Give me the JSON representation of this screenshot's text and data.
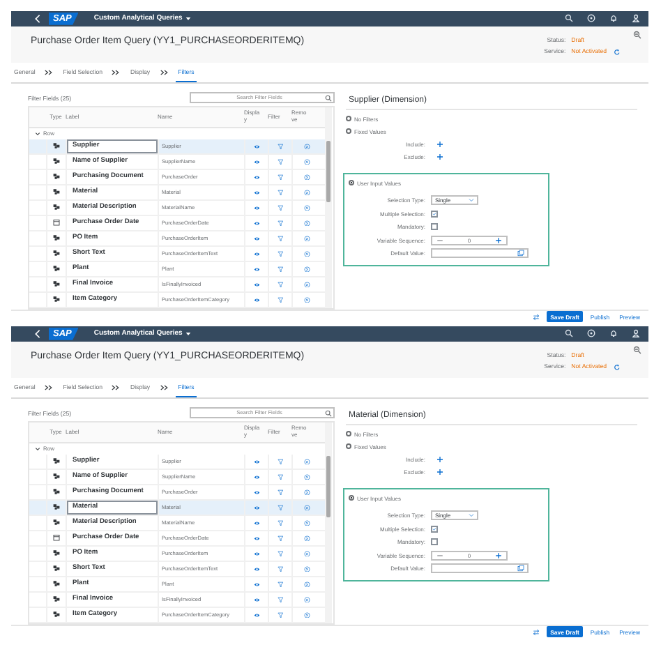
{
  "screens": [
    {
      "shell": {
        "logo": "SAP",
        "app_title": "Custom Analytical Queries"
      },
      "title": "Purchase Order Item Query (YY1_PURCHASEORDERITEMQ)",
      "status_label": "Status:",
      "status": "Draft",
      "service_label": "Service:",
      "service": "Not Activated",
      "tabs": [
        {
          "label": "General",
          "selected": false
        },
        {
          "label": "Field Selection",
          "selected": false
        },
        {
          "label": "Display",
          "selected": false
        },
        {
          "label": "Filters",
          "selected": true
        }
      ],
      "filter_fields": "Filter Fields (25)",
      "search": {
        "placeholder": "Search Filter Fields"
      },
      "columns": [
        "Type",
        "Label",
        "Name",
        "Display",
        "Filter",
        "Remove"
      ],
      "group": {
        "label": "Row",
        "expanded": true
      },
      "rows": [
        {
          "kind": "dimension",
          "label": "Supplier",
          "name": "Supplier",
          "selected": true
        },
        {
          "kind": "dimension",
          "label": "Name of Supplier",
          "name": "SupplierName",
          "selected": false
        },
        {
          "kind": "dimension",
          "label": "Purchasing Document",
          "name": "PurchaseOrder",
          "selected": false
        },
        {
          "kind": "dimension",
          "label": "Material",
          "name": "Material",
          "selected": false
        },
        {
          "kind": "dimension",
          "label": "Material Description",
          "name": "MaterialName",
          "selected": false
        },
        {
          "kind": "date",
          "label": "Purchase Order Date",
          "name": "PurchaseOrderDate",
          "selected": false
        },
        {
          "kind": "dimension",
          "label": "PO Item",
          "name": "PurchaseOrderItem",
          "selected": false
        },
        {
          "kind": "dimension",
          "label": "Short Text",
          "name": "PurchaseOrderItemText",
          "selected": false
        },
        {
          "kind": "dimension",
          "label": "Plant",
          "name": "Plant",
          "selected": false
        },
        {
          "kind": "dimension",
          "label": "Final Invoice",
          "name": "IsFinallyInvoiced",
          "selected": false
        },
        {
          "kind": "dimension",
          "label": "Item Category",
          "name": "PurchaseOrderItemCategory",
          "selected": false
        }
      ],
      "detail": {
        "heading": "Supplier (Dimension)",
        "options": [
          {
            "label": "No Filters",
            "selected": false
          },
          {
            "label": "Fixed Values",
            "selected": false
          }
        ],
        "include": "Include:",
        "exclude": "Exclude:",
        "user_input": {
          "label": "User Input Values",
          "selected": true
        },
        "selection_type_label": "Selection Type:",
        "selection_type": "Single",
        "multiple_label": "Multiple Selection:",
        "multiple": true,
        "mandatory_label": "Mandatory:",
        "mandatory": false,
        "sequence_label": "Variable Sequence:",
        "sequence": "0",
        "default_label": "Default Value:"
      },
      "footer": {
        "buttons": [
          {
            "label": "Save Draft",
            "kind": "emphasized"
          },
          {
            "label": "Publish",
            "kind": "transparent"
          },
          {
            "label": "Preview",
            "kind": "transparent"
          }
        ]
      }
    },
    {
      "shell": {
        "logo": "SAP",
        "app_title": "Custom Analytical Queries"
      },
      "title": "Purchase Order Item Query (YY1_PURCHASEORDERITEMQ)",
      "status_label": "Status:",
      "status": "Draft",
      "service_label": "Service:",
      "service": "Not Activated",
      "tabs": [
        {
          "label": "General",
          "selected": false
        },
        {
          "label": "Field Selection",
          "selected": false
        },
        {
          "label": "Display",
          "selected": false
        },
        {
          "label": "Filters",
          "selected": true
        }
      ],
      "filter_fields": "Filter Fields (25)",
      "search": {
        "placeholder": "Search Filter Fields"
      },
      "columns": [
        "Type",
        "Label",
        "Name",
        "Display",
        "Filter",
        "Remove"
      ],
      "group": {
        "label": "Row",
        "expanded": true
      },
      "rows": [
        {
          "kind": "dimension",
          "label": "Supplier",
          "name": "Supplier",
          "selected": false
        },
        {
          "kind": "dimension",
          "label": "Name of Supplier",
          "name": "SupplierName",
          "selected": false
        },
        {
          "kind": "dimension",
          "label": "Purchasing Document",
          "name": "PurchaseOrder",
          "selected": false
        },
        {
          "kind": "dimension",
          "label": "Material",
          "name": "Material",
          "selected": true
        },
        {
          "kind": "dimension",
          "label": "Material Description",
          "name": "MaterialName",
          "selected": false
        },
        {
          "kind": "date",
          "label": "Purchase Order Date",
          "name": "PurchaseOrderDate",
          "selected": false
        },
        {
          "kind": "dimension",
          "label": "PO Item",
          "name": "PurchaseOrderItem",
          "selected": false
        },
        {
          "kind": "dimension",
          "label": "Short Text",
          "name": "PurchaseOrderItemText",
          "selected": false
        },
        {
          "kind": "dimension",
          "label": "Plant",
          "name": "Plant",
          "selected": false
        },
        {
          "kind": "dimension",
          "label": "Final Invoice",
          "name": "IsFinallyInvoiced",
          "selected": false
        },
        {
          "kind": "dimension",
          "label": "Item Category",
          "name": "PurchaseOrderItemCategory",
          "selected": false
        }
      ],
      "detail": {
        "heading": "Material (Dimension)",
        "options": [
          {
            "label": "No Filters",
            "selected": false
          },
          {
            "label": "Fixed Values",
            "selected": false
          }
        ],
        "include": "Include:",
        "exclude": "Exclude:",
        "user_input": {
          "label": "User Input Values",
          "selected": true
        },
        "selection_type_label": "Selection Type:",
        "selection_type": "Single",
        "multiple_label": "Multiple Selection:",
        "multiple": true,
        "mandatory_label": "Mandatory:",
        "mandatory": false,
        "sequence_label": "Variable Sequence:",
        "sequence": "0",
        "default_label": "Default Value:"
      },
      "footer": {
        "buttons": [
          {
            "label": "Save Draft",
            "kind": "emphasized"
          },
          {
            "label": "Publish",
            "kind": "transparent"
          },
          {
            "label": "Preview",
            "kind": "transparent"
          }
        ]
      }
    }
  ]
}
